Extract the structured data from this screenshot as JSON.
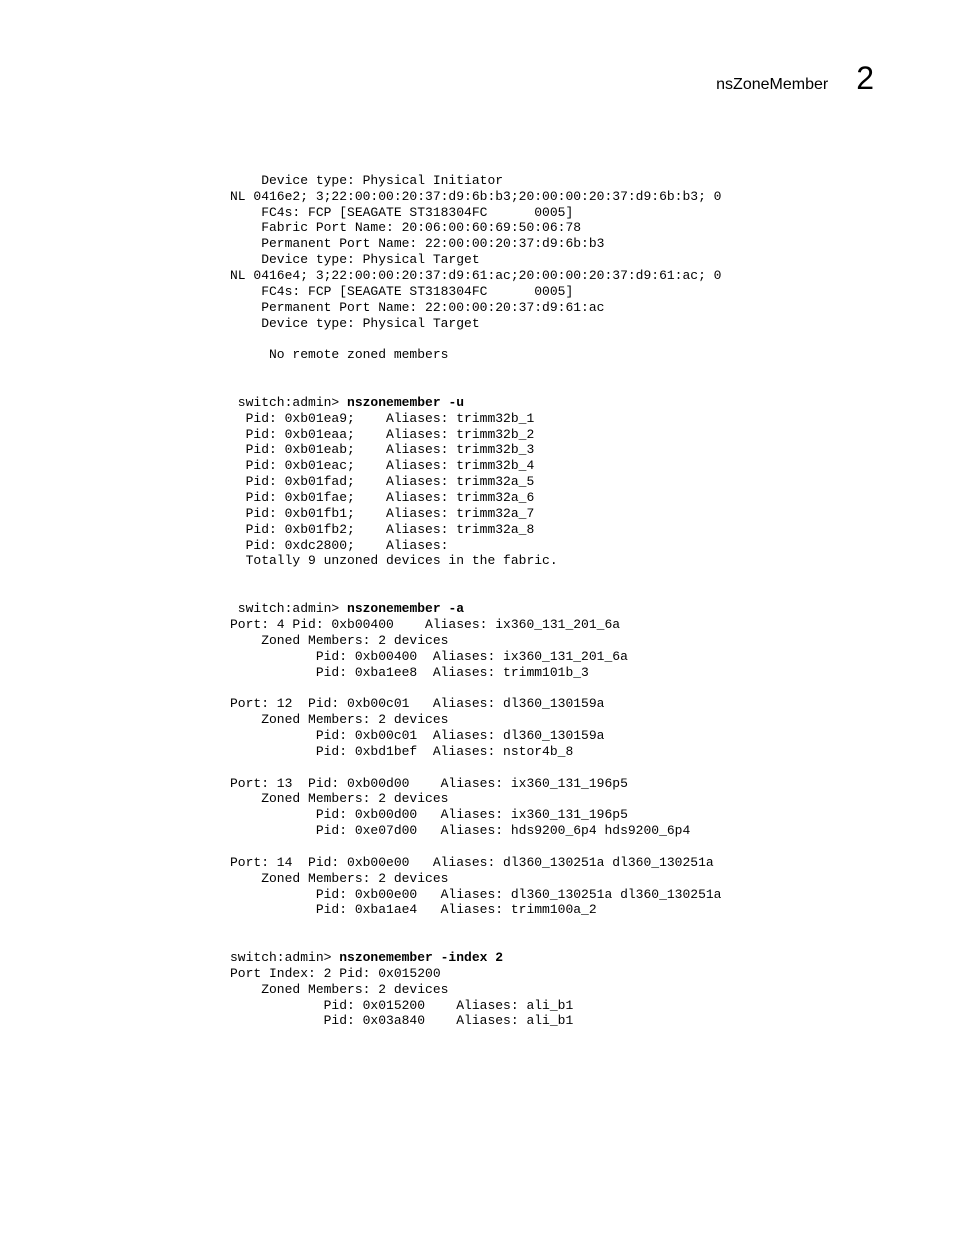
{
  "header": {
    "title": "nsZoneMember",
    "chapter": "2"
  },
  "block1": {
    "l01": "    Device type: Physical Initiator",
    "l02": "NL 0416e2; 3;22:00:00:20:37:d9:6b:b3;20:00:00:20:37:d9:6b:b3; 0",
    "l03": "    FC4s: FCP [SEAGATE ST318304FC      0005]",
    "l04": "    Fabric Port Name: 20:06:00:60:69:50:06:78",
    "l05": "    Permanent Port Name: 22:00:00:20:37:d9:6b:b3",
    "l06": "    Device type: Physical Target",
    "l07": "NL 0416e4; 3;22:00:00:20:37:d9:61:ac;20:00:00:20:37:d9:61:ac; 0",
    "l08": "    FC4s: FCP [SEAGATE ST318304FC      0005]",
    "l09": "    Permanent Port Name: 22:00:00:20:37:d9:61:ac",
    "l10": "    Device type: Physical Target",
    "l11": "",
    "l12": "     No remote zoned members"
  },
  "cmd2": {
    "prompt": " switch:admin> ",
    "command": "nszonemember -u"
  },
  "block2": {
    "l01": "  Pid: 0xb01ea9;    Aliases: trimm32b_1",
    "l02": "  Pid: 0xb01eaa;    Aliases: trimm32b_2",
    "l03": "  Pid: 0xb01eab;    Aliases: trimm32b_3",
    "l04": "  Pid: 0xb01eac;    Aliases: trimm32b_4",
    "l05": "  Pid: 0xb01fad;    Aliases: trimm32a_5",
    "l06": "  Pid: 0xb01fae;    Aliases: trimm32a_6",
    "l07": "  Pid: 0xb01fb1;    Aliases: trimm32a_7",
    "l08": "  Pid: 0xb01fb2;    Aliases: trimm32a_8",
    "l09": "  Pid: 0xdc2800;    Aliases: ",
    "l10": "  Totally 9 unzoned devices in the fabric."
  },
  "cmd3": {
    "prompt": " switch:admin> ",
    "command": "nszonemember -a"
  },
  "block3": {
    "l01": "Port: 4 Pid: 0xb00400    Aliases: ix360_131_201_6a",
    "l02": "    Zoned Members: 2 devices",
    "l03": "           Pid: 0xb00400  Aliases: ix360_131_201_6a",
    "l04": "           Pid: 0xba1ee8  Aliases: trimm101b_3",
    "l05": "",
    "l06": "Port: 12  Pid: 0xb00c01   Aliases: dl360_130159a",
    "l07": "    Zoned Members: 2 devices",
    "l08": "           Pid: 0xb00c01  Aliases: dl360_130159a",
    "l09": "           Pid: 0xbd1bef  Aliases: nstor4b_8",
    "l10": "",
    "l11": "Port: 13  Pid: 0xb00d00    Aliases: ix360_131_196p5",
    "l12": "    Zoned Members: 2 devices",
    "l13": "           Pid: 0xb00d00   Aliases: ix360_131_196p5",
    "l14": "           Pid: 0xe07d00   Aliases: hds9200_6p4 hds9200_6p4",
    "l15": "",
    "l16": "Port: 14  Pid: 0xb00e00   Aliases: dl360_130251a dl360_130251a",
    "l17": "    Zoned Members: 2 devices",
    "l18": "           Pid: 0xb00e00   Aliases: dl360_130251a dl360_130251a",
    "l19": "           Pid: 0xba1ae4   Aliases: trimm100a_2"
  },
  "cmd4": {
    "prompt": "switch:admin> ",
    "command": "nszonemember -index 2"
  },
  "block4": {
    "l01": "Port Index: 2 Pid: 0x015200",
    "l02": "    Zoned Members: 2 devices",
    "l03": "            Pid: 0x015200    Aliases: ali_b1",
    "l04": "            Pid: 0x03a840    Aliases: ali_b1"
  }
}
